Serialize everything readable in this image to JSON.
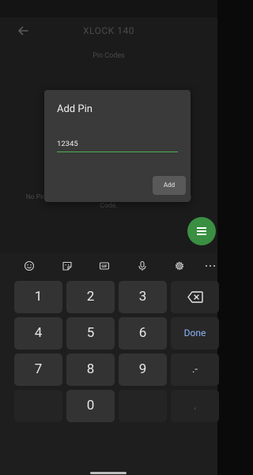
{
  "app": {
    "title": "XLOCK 140",
    "subtitle": "Pin Codes",
    "empty_state_line1": "No Pin Codes added yet. Click on ≡ to add your first Pin",
    "empty_state_line2": "Code.",
    "accent_color": "#4caf50"
  },
  "dialog": {
    "title": "Add Pin",
    "input_value": "12345",
    "add_label": "Add"
  },
  "keyboard": {
    "toolbar_icons": [
      "emoji-icon",
      "sticker-icon",
      "gif-icon",
      "microphone-icon",
      "settings-icon",
      "more-icon"
    ],
    "keys": [
      "1",
      "2",
      "3",
      "4",
      "5",
      "6",
      "7",
      "8",
      "9",
      "0"
    ],
    "done_label": "Done",
    "minus_label": ".-",
    "comma_label": ","
  }
}
